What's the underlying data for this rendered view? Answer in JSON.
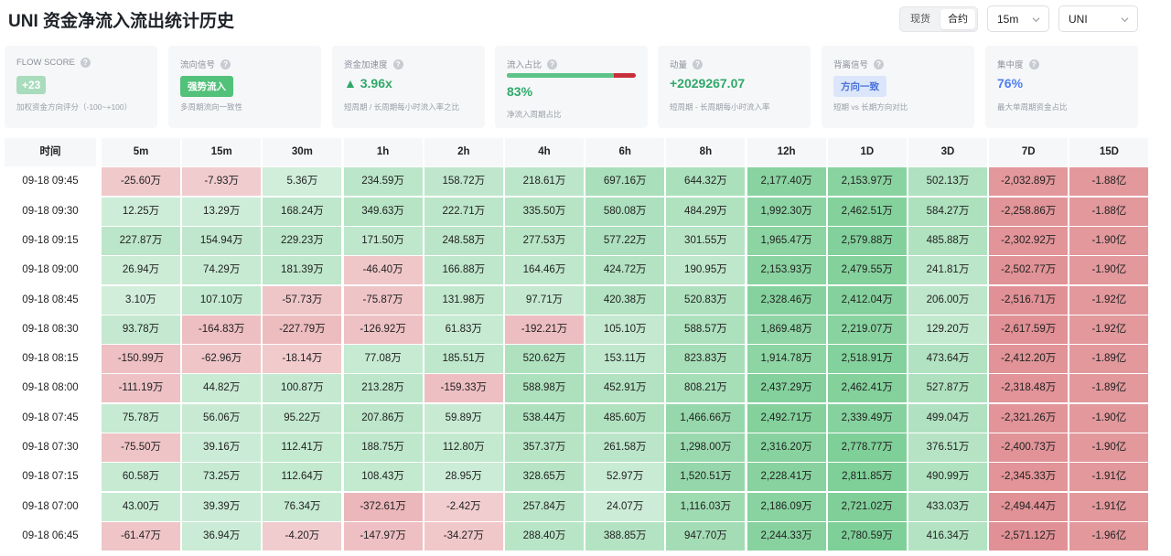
{
  "header": {
    "title": "UNI 资金净流入流出统计历史",
    "market_tabs": [
      "现货",
      "合约"
    ],
    "active_market": "合约",
    "interval": "15m",
    "symbol": "UNI"
  },
  "cards": [
    {
      "label": "FLOW SCORE",
      "value": "+23",
      "sub": "加权资金方向评分（-100~+100）"
    },
    {
      "label": "流向信号",
      "value": "强势流入",
      "sub": "多周期流向一致性"
    },
    {
      "label": "资金加速度",
      "value": "3.96x",
      "sub": "短周期 / 长周期每小时流入率之比"
    },
    {
      "label": "流入占比",
      "value": "83%",
      "sub": "净流入周期占比",
      "ratio": 0.83
    },
    {
      "label": "动量",
      "value": "+2029267.07",
      "sub": "短周期 - 长周期每小时流入率"
    },
    {
      "label": "背离信号",
      "value": "方向一致",
      "sub": "短期 vs 长期方向对比"
    },
    {
      "label": "集中度",
      "value": "76%",
      "sub": "最大单周期资金占比"
    }
  ],
  "colors": {
    "pos_strong": "#7fcf98",
    "pos_light": "#d4efdd",
    "neg_strong": "#e08e93",
    "neg_light": "#f2cfd1",
    "accent_green": "#2fa96a",
    "accent_blue": "#4d7ef0"
  },
  "table": {
    "time_header": "时间",
    "periods": [
      "5m",
      "15m",
      "30m",
      "1h",
      "2h",
      "4h",
      "6h",
      "8h",
      "12h",
      "1D",
      "3D",
      "7D",
      "15D"
    ],
    "rows": [
      {
        "time": "09-18 09:45",
        "values": [
          "-25.60万",
          "-7.93万",
          "5.36万",
          "234.59万",
          "158.72万",
          "218.61万",
          "697.16万",
          "644.32万",
          "2,177.40万",
          "2,153.97万",
          "502.13万",
          "-2,032.89万",
          "-1.88亿"
        ]
      },
      {
        "time": "09-18 09:30",
        "values": [
          "12.25万",
          "13.29万",
          "168.24万",
          "349.63万",
          "222.71万",
          "335.50万",
          "580.08万",
          "484.29万",
          "1,992.30万",
          "2,462.51万",
          "584.27万",
          "-2,258.86万",
          "-1.88亿"
        ]
      },
      {
        "time": "09-18 09:15",
        "values": [
          "227.87万",
          "154.94万",
          "229.23万",
          "171.50万",
          "248.58万",
          "277.53万",
          "577.22万",
          "301.55万",
          "1,965.47万",
          "2,579.88万",
          "485.88万",
          "-2,302.92万",
          "-1.90亿"
        ]
      },
      {
        "time": "09-18 09:00",
        "values": [
          "26.94万",
          "74.29万",
          "181.39万",
          "-46.40万",
          "166.88万",
          "164.46万",
          "424.72万",
          "190.95万",
          "2,153.93万",
          "2,479.55万",
          "241.81万",
          "-2,502.77万",
          "-1.90亿"
        ]
      },
      {
        "time": "09-18 08:45",
        "values": [
          "3.10万",
          "107.10万",
          "-57.73万",
          "-75.87万",
          "131.98万",
          "97.71万",
          "420.38万",
          "520.83万",
          "2,328.46万",
          "2,412.04万",
          "206.00万",
          "-2,516.71万",
          "-1.92亿"
        ]
      },
      {
        "time": "09-18 08:30",
        "values": [
          "93.78万",
          "-164.83万",
          "-227.79万",
          "-126.92万",
          "61.83万",
          "-192.21万",
          "105.10万",
          "588.57万",
          "1,869.48万",
          "2,219.07万",
          "129.20万",
          "-2,617.59万",
          "-1.92亿"
        ]
      },
      {
        "time": "09-18 08:15",
        "values": [
          "-150.99万",
          "-62.96万",
          "-18.14万",
          "77.08万",
          "185.51万",
          "520.62万",
          "153.11万",
          "823.83万",
          "1,914.78万",
          "2,518.91万",
          "473.64万",
          "-2,412.20万",
          "-1.89亿"
        ]
      },
      {
        "time": "09-18 08:00",
        "values": [
          "-111.19万",
          "44.82万",
          "100.87万",
          "213.28万",
          "-159.33万",
          "588.98万",
          "452.91万",
          "808.21万",
          "2,437.29万",
          "2,462.41万",
          "527.87万",
          "-2,318.48万",
          "-1.89亿"
        ]
      },
      {
        "time": "09-18 07:45",
        "values": [
          "75.78万",
          "56.06万",
          "95.22万",
          "207.86万",
          "59.89万",
          "538.44万",
          "485.60万",
          "1,466.66万",
          "2,492.71万",
          "2,339.49万",
          "499.04万",
          "-2,321.26万",
          "-1.90亿"
        ]
      },
      {
        "time": "09-18 07:30",
        "values": [
          "-75.50万",
          "39.16万",
          "112.41万",
          "188.75万",
          "112.80万",
          "357.37万",
          "261.58万",
          "1,298.00万",
          "2,316.20万",
          "2,778.77万",
          "376.51万",
          "-2,400.73万",
          "-1.90亿"
        ]
      },
      {
        "time": "09-18 07:15",
        "values": [
          "60.58万",
          "73.25万",
          "112.64万",
          "108.43万",
          "28.95万",
          "328.65万",
          "52.97万",
          "1,520.51万",
          "2,228.41万",
          "2,811.85万",
          "490.99万",
          "-2,345.33万",
          "-1.91亿"
        ]
      },
      {
        "time": "09-18 07:00",
        "values": [
          "43.00万",
          "39.39万",
          "76.34万",
          "-372.61万",
          "-2.42万",
          "257.84万",
          "24.07万",
          "1,116.03万",
          "2,186.09万",
          "2,721.02万",
          "433.03万",
          "-2,494.44万",
          "-1.91亿"
        ]
      },
      {
        "time": "09-18 06:45",
        "values": [
          "-61.47万",
          "36.94万",
          "-4.20万",
          "-147.97万",
          "-34.27万",
          "288.40万",
          "388.85万",
          "947.70万",
          "2,244.33万",
          "2,780.59万",
          "416.34万",
          "-2,571.12万",
          "-1.96亿"
        ]
      }
    ]
  }
}
